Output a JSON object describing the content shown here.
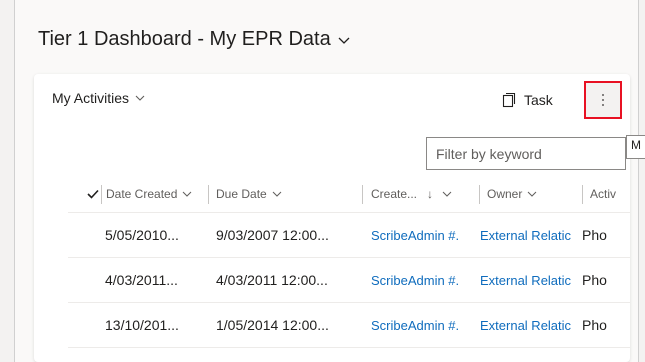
{
  "page": {
    "title": "Tier 1 Dashboard - My EPR Data"
  },
  "card": {
    "view_label": "My Activities",
    "task_label": "Task",
    "more_label": "⋮",
    "filter_placeholder": "Filter by keyword",
    "tooltip_fragment": "M"
  },
  "grid": {
    "columns": [
      "Date Created",
      "Due Date",
      "Create...",
      "Owner",
      "Activ"
    ],
    "sort_indicator": "↓",
    "rows": [
      {
        "date_created": "5/05/2010...",
        "due_date": "9/03/2007 12:00...",
        "created_by": "ScribeAdmin #.",
        "owner": "External Relatic",
        "activity": "Pho"
      },
      {
        "date_created": "4/03/2011...",
        "due_date": "4/03/2011 12:00...",
        "created_by": "ScribeAdmin #.",
        "owner": "External Relatic",
        "activity": "Pho"
      },
      {
        "date_created": "13/10/201...",
        "due_date": "1/05/2014 12:00...",
        "created_by": "ScribeAdmin #.",
        "owner": "External Relatic",
        "activity": "Pho"
      }
    ]
  },
  "colors": {
    "link": "#0f6cbd",
    "highlight_border": "#e81123"
  }
}
